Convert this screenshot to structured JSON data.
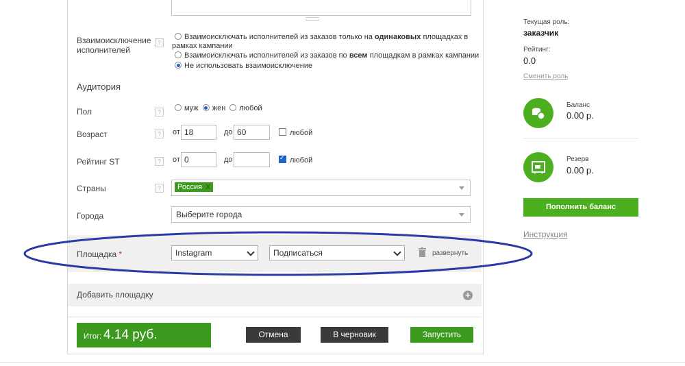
{
  "exclusion": {
    "label": "Взаимоисключение исполнителей",
    "option1_prefix": "Взаимоисключать исполнителей из заказов только на ",
    "option1_bold": "одинаковых",
    "option1_suffix": " площадках в",
    "option1_line2": "рамках кампании",
    "option2_prefix": "Взаимоисключать исполнителей из заказов по ",
    "option2_bold": "всем",
    "option2_suffix": " площадкам в рамках кампании",
    "option3": "Не использовать взаимоисключение",
    "selected": 3
  },
  "audience": {
    "title": "Аудитория"
  },
  "gender": {
    "label": "Пол",
    "male": "муж",
    "female": "жен",
    "any": "любой",
    "selected": "female"
  },
  "age": {
    "label": "Возраст",
    "from_label": "от",
    "from_value": "18",
    "to_label": "до",
    "to_value": "60",
    "any_label": "любой",
    "any_checked": false
  },
  "rating": {
    "label": "Рейтинг ST",
    "from_label": "от",
    "from_value": "0",
    "to_label": "до",
    "to_value": "",
    "any_label": "любой",
    "any_checked": true
  },
  "countries": {
    "label": "Страны",
    "tag": "Россия",
    "tag_remove": "X"
  },
  "cities": {
    "label": "Города",
    "placeholder": "Выберите города"
  },
  "platform": {
    "label": "Площадка",
    "required_mark": "*",
    "network": "Instagram",
    "action": "Подписаться",
    "expand_label": "развернуть"
  },
  "add_platform": {
    "label": "Добавить площадку"
  },
  "footer": {
    "total_prefix": "Итог:",
    "total_value": "4.14 руб.",
    "cancel": "Отмена",
    "draft": "В черновик",
    "launch": "Запустить"
  },
  "sidebar": {
    "role_label": "Текущая роль:",
    "role_value": "заказчик",
    "rating_label": "Рейтинг:",
    "rating_value": "0.0",
    "change_role": "Сменить роль",
    "balance_label": "Баланс",
    "balance_value": "0.00 р.",
    "reserve_label": "Резерв",
    "reserve_value": "0.00 р.",
    "topup": "Пополнить баланс",
    "instruction": "Инструкция"
  },
  "colors": {
    "accent_green": "#3c9b1e",
    "highlight_ellipse": "#2a3aa8",
    "radio_blue": "#1e64c8"
  },
  "icons": [
    "help-icon",
    "trash-icon",
    "plus-circle-icon",
    "coins-icon",
    "safe-icon",
    "chevron-down-icon"
  ]
}
